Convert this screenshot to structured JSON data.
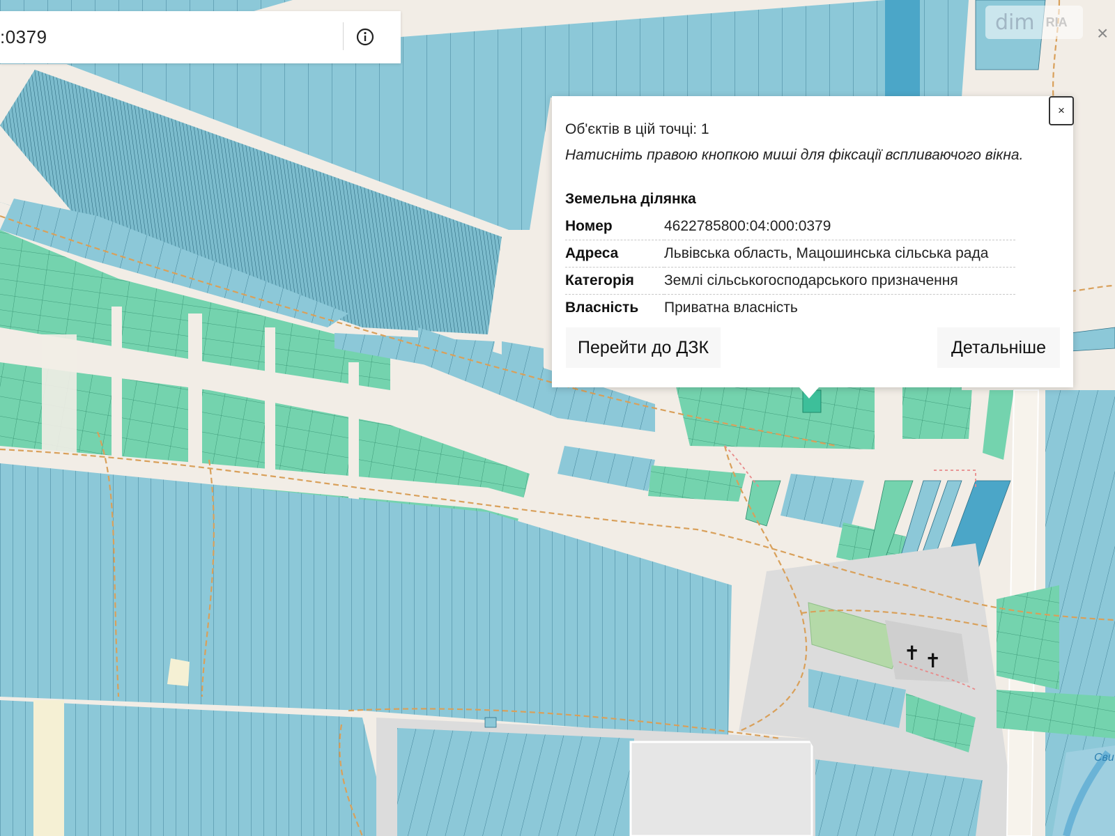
{
  "search": {
    "value": ":0379"
  },
  "watermark": {
    "brand": "dim",
    "brand_suffix": "RIA"
  },
  "popup": {
    "objects_count": "Об'єктів в цій точці: 1",
    "hint": "Натисніть правою кнопкою миші для фіксації вспливаючого вікна.",
    "section_title": "Земельна ділянка",
    "properties": [
      {
        "key": "Номер",
        "value": "4622785800:04:000:0379"
      },
      {
        "key": "Адреса",
        "value": "Львівська область, Мацошинська сільська рада"
      },
      {
        "key": "Категорія",
        "value": "Землі сільськогосподарського призначення"
      },
      {
        "key": "Власність",
        "value": "Приватна власність"
      }
    ],
    "goto_button": "Перейти до ДЗК",
    "details_button": "Детальніше",
    "close_label": "×"
  },
  "map": {
    "partial_label": "Сви",
    "colors": {
      "agricultural": "#8cc8d8",
      "residential": "#74d3ae",
      "selected": "#3dbf9a",
      "background": "#f2ede6",
      "boundary": "#d9a05a",
      "cemetery": "#b4d9a8",
      "gray_zone": "#dcdcdc"
    }
  }
}
